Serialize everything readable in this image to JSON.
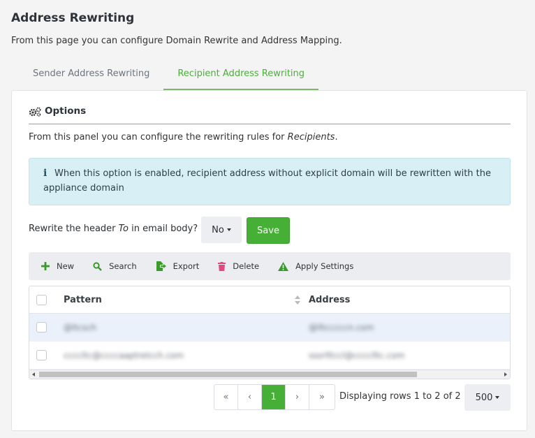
{
  "page": {
    "title": "Address Rewriting",
    "description": "From this page you can configure Domain Rewrite and Address Mapping."
  },
  "tabs": [
    {
      "label": "Sender Address Rewriting",
      "active": false
    },
    {
      "label": "Recipient Address Rewriting",
      "active": true
    }
  ],
  "options": {
    "header": "Options",
    "description_prefix": "From this panel you can configure the rewriting rules for ",
    "description_emphasis": "Recipients",
    "description_suffix": ".",
    "info_text": "When this option is enabled, recipient address without explicit domain will be rewritten with the appliance domain",
    "rewrite_label_prefix": "Rewrite the header ",
    "rewrite_label_emphasis": "To",
    "rewrite_label_suffix": " in email body?",
    "rewrite_value": "No",
    "save_label": "Save"
  },
  "toolbar": {
    "new_label": "New",
    "search_label": "Search",
    "export_label": "Export",
    "delete_label": "Delete",
    "apply_label": "Apply Settings"
  },
  "grid": {
    "columns": [
      "Pattern",
      "Address"
    ],
    "rows": [
      {
        "pattern": "@ltcsch",
        "address": "@lltcccccn.com"
      },
      {
        "pattern": "ccccltc@ccccaaptrelcch.com",
        "address": "sssrlltccl@cccclltc.com"
      }
    ]
  },
  "pagination": {
    "first": "«",
    "prev": "‹",
    "current": "1",
    "next": "›",
    "last": "»",
    "info": "Displaying rows 1 to 2 of 2",
    "page_size": "500"
  },
  "colors": {
    "accent": "#45b035",
    "tab_active": "#4cae3b",
    "info_bg": "#d8f0f5",
    "delete_icon": "#e5487b",
    "warning_icon": "#3b9a2c"
  }
}
